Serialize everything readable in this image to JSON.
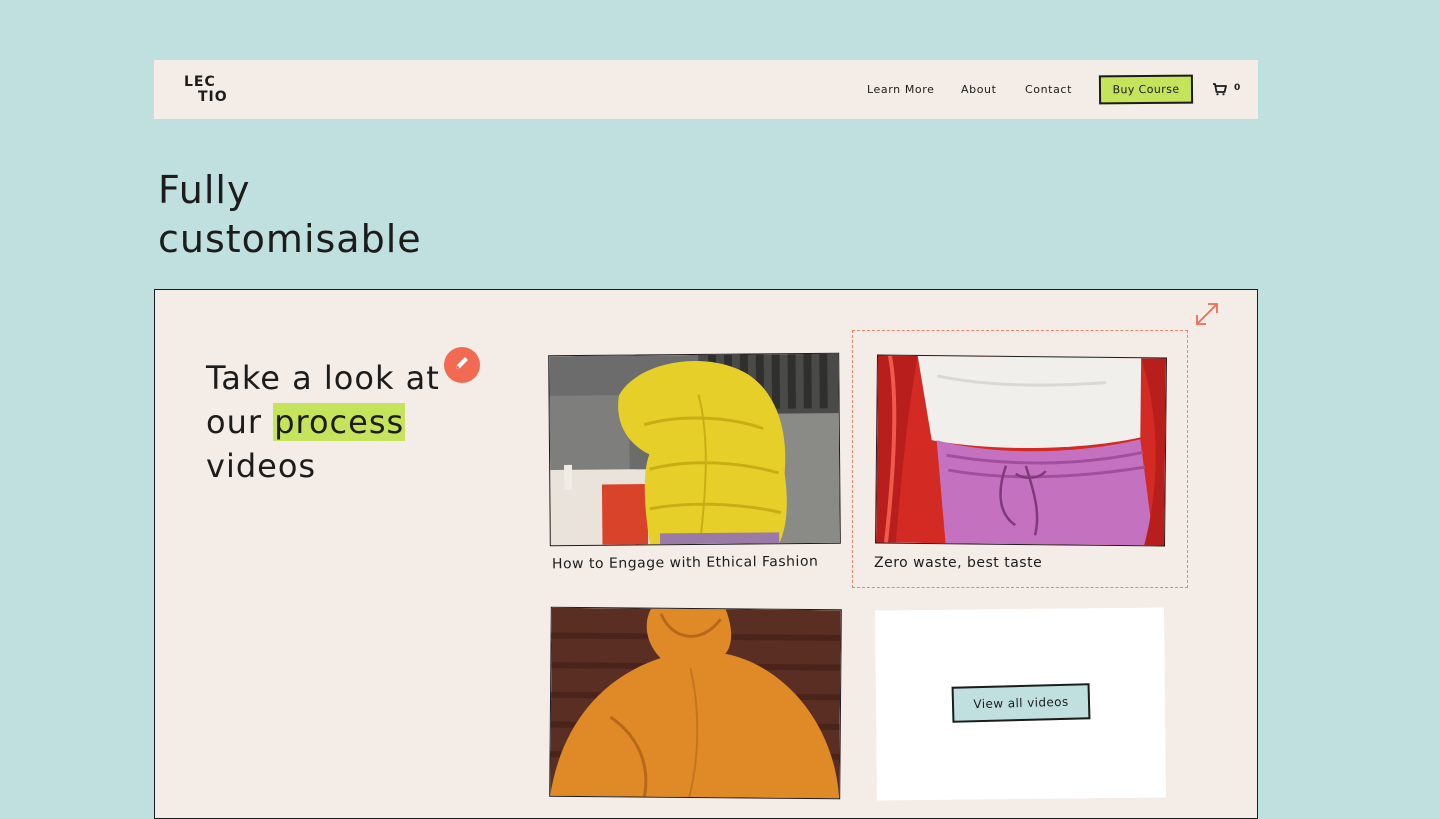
{
  "header": {
    "logo": [
      "LEC",
      "TIO"
    ],
    "nav": [
      "Learn More",
      "About",
      "Contact"
    ],
    "buy_label": "Buy Course",
    "cart_count": "0"
  },
  "section": {
    "title_lines": [
      "Fully",
      "customisable"
    ]
  },
  "editor": {
    "heading": {
      "line1": "Take a look at",
      "line2_pre": "our ",
      "line2_highlight": "process",
      "line3": "videos"
    },
    "videos": [
      {
        "title": "How to Engage with Ethical Fashion",
        "selected": false
      },
      {
        "title": "Zero waste, best taste",
        "selected": true
      },
      {
        "title": "",
        "selected": false
      }
    ],
    "view_all_label": "View all videos",
    "icons": [
      "pencil-icon",
      "expand-icon",
      "cart-icon"
    ]
  },
  "colors": {
    "background": "#c0e0df",
    "surface": "#f3ece7",
    "accent_green": "#c6e35c",
    "accent_coral": "#f26a52",
    "ink": "#1c1c1c"
  }
}
